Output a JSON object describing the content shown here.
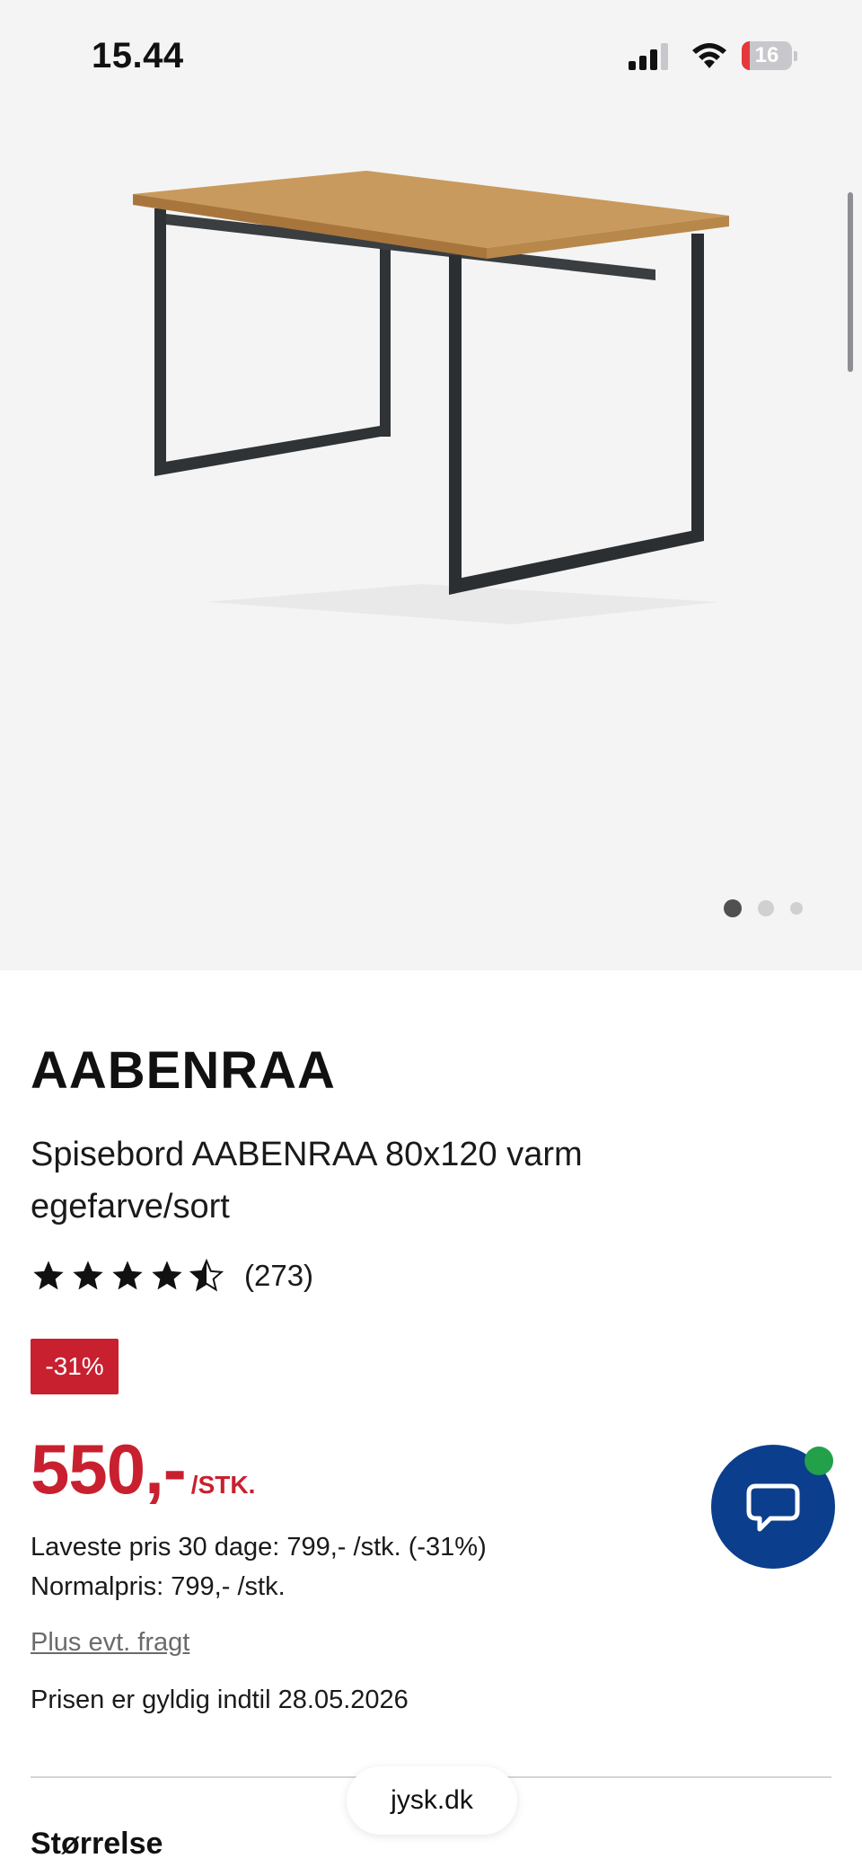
{
  "status_bar": {
    "time": "15.44",
    "battery": "16",
    "battery_level": 0.16
  },
  "gallery": {
    "image_count": 3,
    "active_index": 0,
    "image_icon": "dining-table-photo"
  },
  "product": {
    "brand": "AABENRAA",
    "name": "Spisebord AABENRAA 80x120 varm egefarve/sort",
    "rating": 4.5,
    "review_count": "(273)",
    "discount": "-31%",
    "price": "550,-",
    "price_unit": "/STK.",
    "lowest_price": "Laveste pris 30 dage: 799,- /stk. (-31%)",
    "normal_price": "Normalpris: 799,- /stk.",
    "freight_link": "Plus evt. fragt",
    "valid_until": "Prisen er gyldig indtil 28.05.2026",
    "size_heading": "Størrelse"
  },
  "chat": {
    "icon": "chat-bubble-icon",
    "status_color": "#23a04a"
  },
  "browser": {
    "url": "jysk.dk"
  },
  "colors": {
    "accent": "#c8202f",
    "chat": "#0b3e8c",
    "gallery_bg": "#f4f4f4"
  }
}
